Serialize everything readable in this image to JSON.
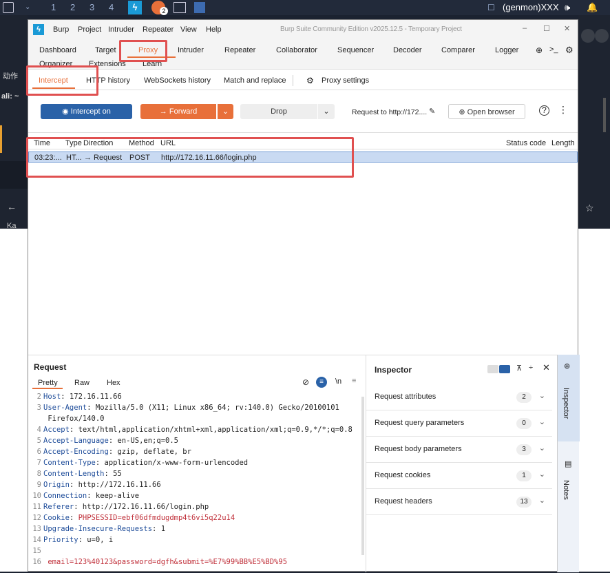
{
  "taskbar": {
    "workspaces": [
      "1",
      "2",
      "3",
      "4"
    ],
    "badge": "2",
    "user": "(genmon)XXX"
  },
  "bg": {
    "left_text_1": "动作",
    "left_text_2": "ali: ~",
    "left_text_3": "Ka"
  },
  "window": {
    "title": "Burp Suite Community Edition v2025.12.5 - Temporary Project",
    "menu": [
      "Burp",
      "Project",
      "Intruder",
      "Repeater",
      "View",
      "Help"
    ]
  },
  "tabs": {
    "dashboard": "Dashboard",
    "target": "Target",
    "proxy": "Proxy",
    "intruder": "Intruder",
    "repeater": "Repeater",
    "collaborator": "Collaborator",
    "sequencer": "Sequencer",
    "decoder": "Decoder",
    "comparer": "Comparer",
    "logger": "Logger",
    "organizer": "Organizer",
    "extensions": "Extensions",
    "learn": "Learn"
  },
  "subtabs": {
    "intercept": "Intercept",
    "http_history": "HTTP history",
    "websockets": "WebSockets history",
    "match_replace": "Match and replace",
    "proxy_settings": "Proxy settings"
  },
  "toolbar": {
    "intercept_on": "Intercept on",
    "forward": "→  Forward",
    "drop": "Drop",
    "request_to": "Request to http://172....",
    "open_browser": "Open browser"
  },
  "table": {
    "headers": [
      "Time",
      "Type",
      "Direction",
      "Method",
      "URL",
      "Status code",
      "Length"
    ],
    "row": {
      "time": "03:23:...",
      "type": "HT...",
      "direction": "→  Request",
      "method": "POST",
      "url": "http://172.16.11.66/login.php"
    }
  },
  "request": {
    "title": "Request",
    "tabs": [
      "Pretty",
      "Raw",
      "Hex"
    ],
    "lines": [
      {
        "n": "2",
        "h": "Host",
        "v": "172.16.11.66"
      },
      {
        "n": "3",
        "h": "User-Agent",
        "v": "Mozilla/5.0 (X11; Linux x86_64; rv:140.0) Gecko/20100101"
      },
      {
        "n": "",
        "h": "",
        "v": "Firefox/140.0"
      },
      {
        "n": "4",
        "h": "Accept",
        "v": "text/html,application/xhtml+xml,application/xml;q=0.9,*/*;q=0.8"
      },
      {
        "n": "5",
        "h": "Accept-Language",
        "v": "en-US,en;q=0.5"
      },
      {
        "n": "6",
        "h": "Accept-Encoding",
        "v": "gzip, deflate, br"
      },
      {
        "n": "7",
        "h": "Content-Type",
        "v": "application/x-www-form-urlencoded"
      },
      {
        "n": "8",
        "h": "Content-Length",
        "v": "55"
      },
      {
        "n": "9",
        "h": "Origin",
        "v": "http://172.16.11.66"
      },
      {
        "n": "10",
        "h": "Connection",
        "v": "keep-alive"
      },
      {
        "n": "11",
        "h": "Referer",
        "v": "http://172.16.11.66/login.php"
      },
      {
        "n": "12",
        "h": "Cookie",
        "v": "PHPSESSID=ebf06dfmdugdmp4t6vi5q22u14"
      },
      {
        "n": "13",
        "h": "Upgrade-Insecure-Requests",
        "v": "1"
      },
      {
        "n": "14",
        "h": "Priority",
        "v": "u=0, i"
      },
      {
        "n": "15",
        "h": "",
        "v": ""
      },
      {
        "n": "16",
        "h": "",
        "v": "email=123%40123&password=dgfh&submit=%E7%99%BB%E5%BD%95"
      }
    ]
  },
  "inspector": {
    "title": "Inspector",
    "rows": [
      {
        "label": "Request attributes",
        "count": "2"
      },
      {
        "label": "Request query parameters",
        "count": "0"
      },
      {
        "label": "Request body parameters",
        "count": "3"
      },
      {
        "label": "Request cookies",
        "count": "1"
      },
      {
        "label": "Request headers",
        "count": "13"
      }
    ],
    "side_tabs": [
      "Inspector",
      "Notes"
    ]
  },
  "colors": {
    "accent": "#e8703a",
    "highlight": "#e05050",
    "selected_row": "#c9daf2",
    "intercept_btn": "#2a62a8"
  }
}
